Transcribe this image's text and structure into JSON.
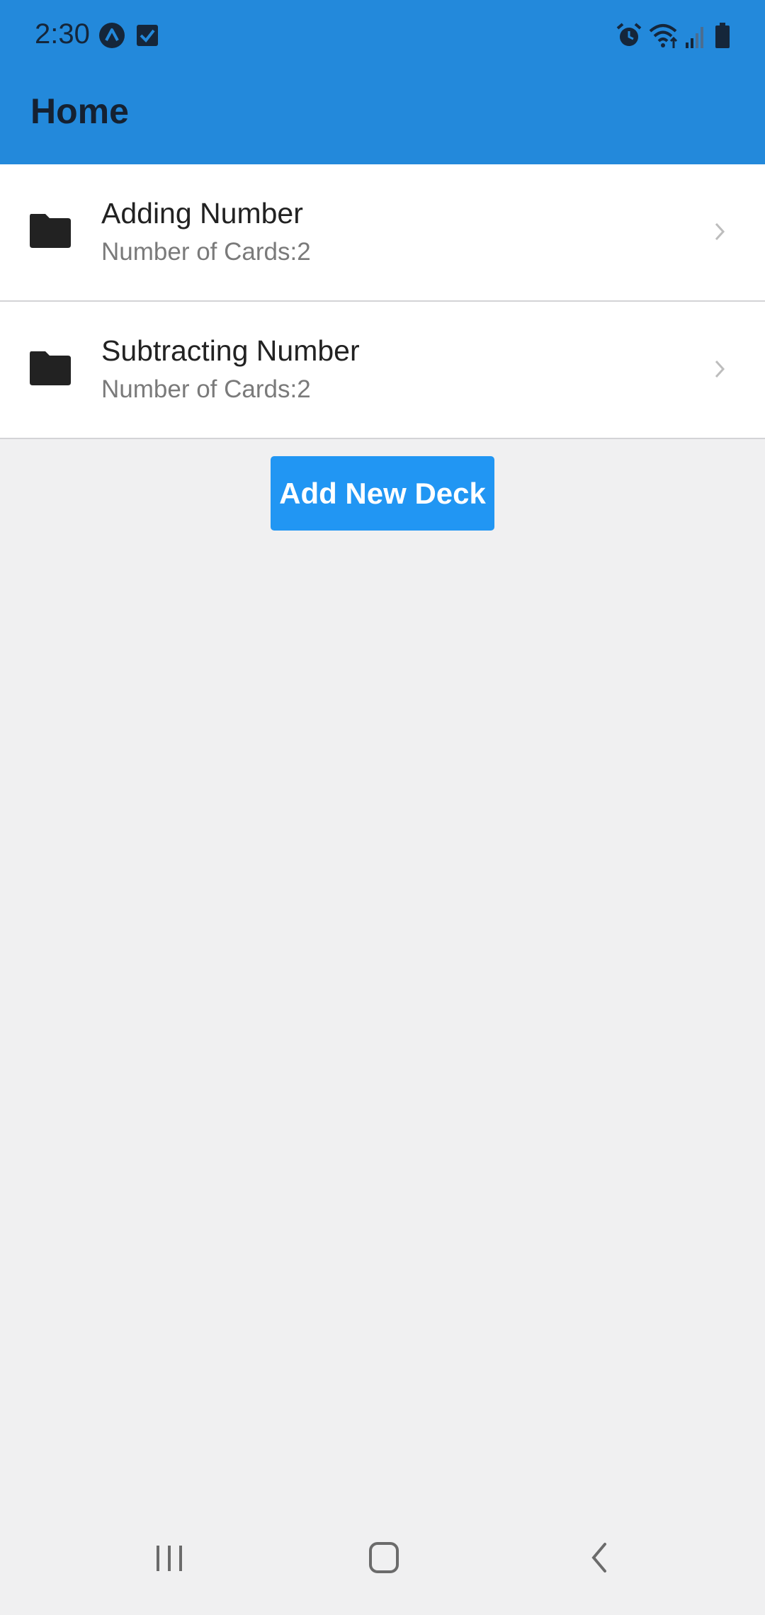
{
  "status_bar": {
    "time": "2:30",
    "left_icons": [
      "app-a-icon",
      "checkbox-icon"
    ],
    "right_icons": [
      "alarm-icon",
      "wifi-icon",
      "signal-icon",
      "battery-icon"
    ]
  },
  "header": {
    "title": "Home"
  },
  "decks": [
    {
      "name": "Adding Number",
      "count_label": "Number of Cards:2"
    },
    {
      "name": "Subtracting Number",
      "count_label": "Number of Cards:2"
    }
  ],
  "actions": {
    "add_deck_label": "Add New Deck"
  },
  "navigation": {
    "buttons": [
      "recents-icon",
      "home-icon",
      "back-icon"
    ]
  },
  "colors": {
    "header_bg": "#2389db",
    "button_bg": "#2196f3",
    "page_bg": "#f0f0f1"
  }
}
